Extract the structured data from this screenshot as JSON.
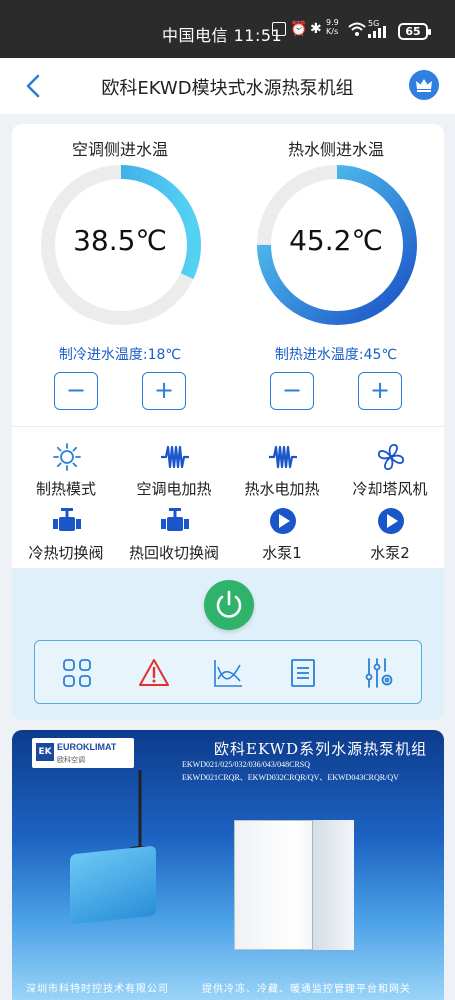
{
  "status_bar": {
    "carrier_time": "中国电信 11:51",
    "net_speed": "9.9 K/s",
    "network": "5G",
    "battery": "65"
  },
  "header": {
    "title": "欧科EKWD模块式水源热泵机组"
  },
  "gauges": [
    {
      "title": "空调侧进水温",
      "value": "38.5℃",
      "fill_fraction": 0.32,
      "setpoint_label": "制冷进水温度:18℃",
      "minus": "−",
      "plus": "+"
    },
    {
      "title": "热水侧进水温",
      "value": "45.2℃",
      "fill_fraction": 0.75,
      "setpoint_label": "制热进水温度:45℃",
      "minus": "−",
      "plus": "+"
    }
  ],
  "status_tiles": [
    {
      "label": "制热模式",
      "icon": "sun-icon"
    },
    {
      "label": "空调电加热",
      "icon": "heater-icon"
    },
    {
      "label": "热水电加热",
      "icon": "heater-icon"
    },
    {
      "label": "冷却塔风机",
      "icon": "fan-icon"
    },
    {
      "label": "冷热切换阀",
      "icon": "valve-icon"
    },
    {
      "label": "热回收切换阀",
      "icon": "valve-icon"
    },
    {
      "label": "水泵1",
      "icon": "pump-icon"
    },
    {
      "label": "水泵2",
      "icon": "pump-icon"
    }
  ],
  "toolbar": {
    "items": [
      "grid-icon",
      "alarm-icon",
      "chart-icon",
      "list-icon",
      "settings-icon"
    ]
  },
  "colors": {
    "accent": "#2b7fd8",
    "gauge_light": "#4fd0f2",
    "gauge_dark": "#1a55c9",
    "power": "#2fb36b",
    "alarm": "#e03030"
  },
  "banner": {
    "logo_ek": "EK",
    "logo_name": "EUROKLIMAT",
    "logo_sub": "欧科空调",
    "title": "欧科EKWD系列水源热泵机组",
    "models": [
      "EKWD021/025/032/036/043/048CRSQ",
      "EKWD021CRQR、EKWD032CRQR/QV、EKWD043CRQR/QV"
    ],
    "footer_left": "深圳市科特时控技术有限公司",
    "footer_right": "提供冷冻、冷藏、暖通监控管理平台和网关"
  }
}
